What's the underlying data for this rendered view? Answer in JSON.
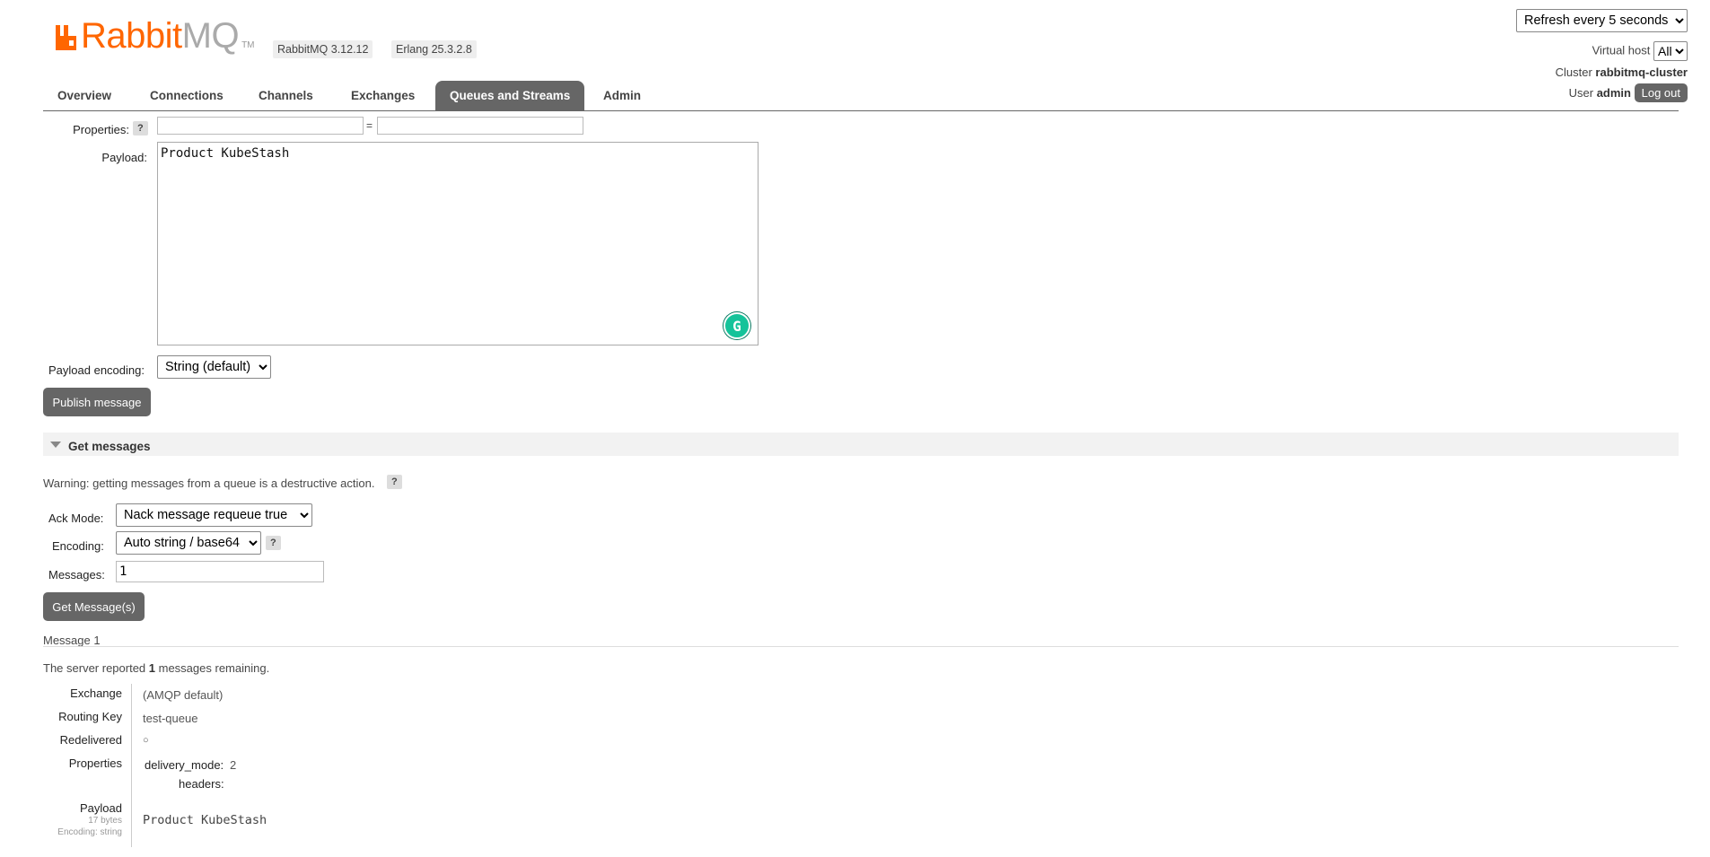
{
  "header": {
    "logo_word": "Rabbit",
    "logo_mq": "MQ",
    "logo_tm": "TM",
    "version_badge": "RabbitMQ 3.12.12",
    "erlang_badge": "Erlang 25.3.2.8",
    "refresh_select": "Refresh every 5 seconds",
    "virtual_host_label": "Virtual host",
    "virtual_host_value": "All",
    "cluster_label": "Cluster",
    "cluster_name": "rabbitmq-cluster",
    "user_label": "User",
    "user_name": "admin",
    "logout_label": "Log out"
  },
  "nav": {
    "tabs": [
      {
        "label": "Overview",
        "active": false
      },
      {
        "label": "Connections",
        "active": false
      },
      {
        "label": "Channels",
        "active": false
      },
      {
        "label": "Exchanges",
        "active": false
      },
      {
        "label": "Queues and Streams",
        "active": true
      },
      {
        "label": "Admin",
        "active": false
      }
    ]
  },
  "publish": {
    "properties_label": "Properties:",
    "help": "?",
    "equals": "=",
    "property_key_value": "",
    "property_value_value": "",
    "payload_label": "Payload:",
    "payload_value": "Product KubeStash",
    "grammarly_icon_glyph": "G",
    "payload_encoding_label": "Payload encoding:",
    "payload_encoding_value": "String (default)",
    "publish_button": "Publish message"
  },
  "get_messages": {
    "section_title": "Get messages",
    "warning": "Warning: getting messages from a queue is a destructive action.",
    "help": "?",
    "ack_mode_label": "Ack Mode:",
    "ack_mode_value": "Nack message requeue true",
    "encoding_label": "Encoding:",
    "encoding_value": "Auto string / base64",
    "messages_label": "Messages:",
    "messages_value": "1",
    "get_button": "Get Message(s)"
  },
  "message": {
    "title": "Message 1",
    "remaining_prefix": "The server reported ",
    "remaining_count": "1",
    "remaining_suffix": " messages remaining.",
    "exchange_label": "Exchange",
    "exchange_value": "(AMQP default)",
    "routing_key_label": "Routing Key",
    "routing_key_value": "test-queue",
    "redelivered_label": "Redelivered",
    "redelivered_value": "○",
    "properties_label": "Properties",
    "delivery_mode_label": "delivery_mode:",
    "delivery_mode_value": "2",
    "headers_label": "headers:",
    "payload_label": "Payload",
    "payload_size": "17 bytes",
    "payload_encoding": "Encoding: string",
    "payload_value": "Product KubeStash"
  },
  "colors": {
    "brand_orange": "#ff6600",
    "tab_active": "#666666",
    "button": "#666666"
  }
}
